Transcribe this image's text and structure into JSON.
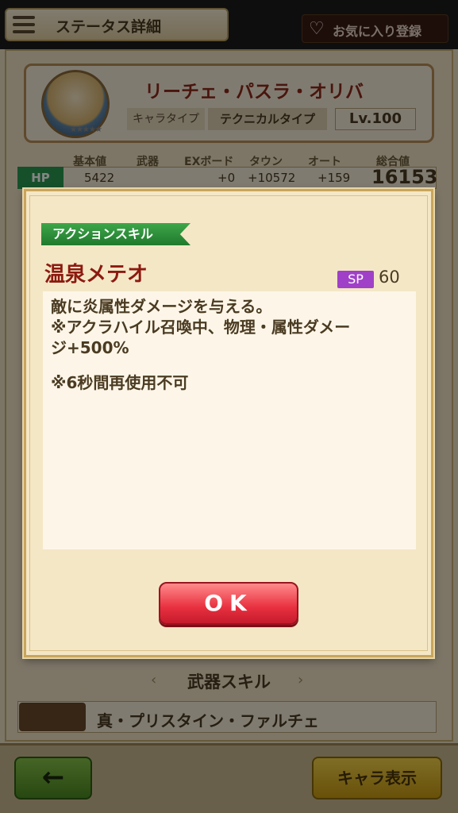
{
  "header": {
    "title": "ステータス詳細",
    "favorite_label": "お気に入り登録"
  },
  "character": {
    "name": "リーチェ・パスラ・オリバ",
    "type_label": "キャラタイプ",
    "type_value": "テクニカルタイプ",
    "level": "Lv.100",
    "stars": "★★★★★"
  },
  "stats": {
    "headers": [
      "基本値",
      "武器",
      "EXボード",
      "タウン",
      "オート",
      "総合値"
    ],
    "hp": {
      "label": "HP",
      "base": "5422",
      "weapon": "",
      "exboard": "+0",
      "town": "+10572",
      "auto": "+159",
      "total": "16153"
    }
  },
  "dialog": {
    "badge": "アクションスキル",
    "skill_name": "温泉メテオ",
    "sp_label": "SP",
    "sp_value": "60",
    "description": [
      "敵に炎属性ダメージを与える。",
      "※アクラハイル召喚中、物理・属性ダメー",
      "ジ+500%",
      "※6秒間再使用不可"
    ],
    "ok_label": "OK"
  },
  "weapon_skill": {
    "title": "武器スキル",
    "weapon_name": "真・プリスタイン・ファルチェ"
  },
  "footer": {
    "back_icon": "←",
    "char_view_label": "キャラ表示"
  },
  "colors": {
    "skill_badge": "#2e8f3c",
    "sp_badge": "#a040c8",
    "ok_button": "#e83040",
    "skill_name": "#8c1a10"
  }
}
